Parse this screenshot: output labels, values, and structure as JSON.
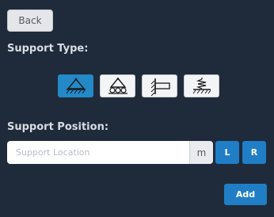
{
  "back_label": "Back",
  "support_type_label": "Support Type:",
  "support_types": [
    {
      "icon": "pin-support-icon",
      "selected": true
    },
    {
      "icon": "roller-support-icon",
      "selected": false
    },
    {
      "icon": "fixed-support-icon",
      "selected": false
    },
    {
      "icon": "spring-support-icon",
      "selected": false
    }
  ],
  "support_position_label": "Support Position:",
  "position_input": {
    "placeholder": "Support Location",
    "value": ""
  },
  "unit": "m",
  "left_label": "L",
  "right_label": "R",
  "add_label": "Add",
  "colors": {
    "background": "#1f2a3a",
    "accent": "#1f7ec5",
    "selected": "#2389c7"
  }
}
